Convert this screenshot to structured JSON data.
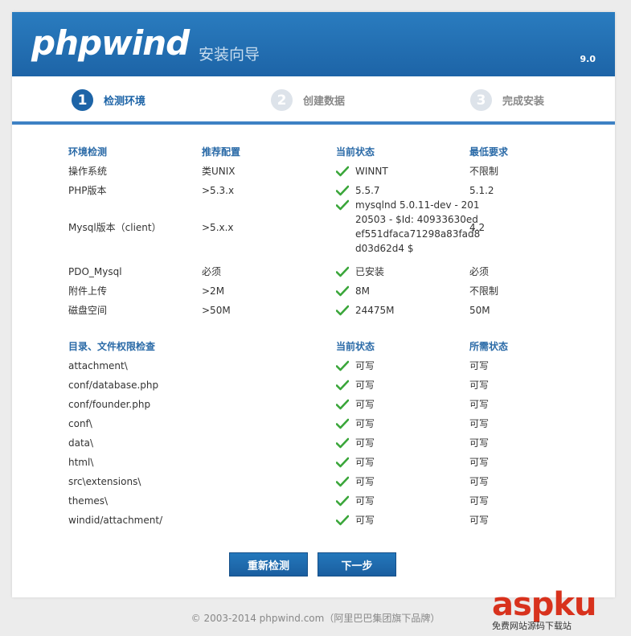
{
  "header": {
    "logo": "phpwind",
    "subtitle": "安装向导",
    "version": "9.0"
  },
  "steps": [
    {
      "num": "1",
      "label": "检测环境"
    },
    {
      "num": "2",
      "label": "创建数据"
    },
    {
      "num": "3",
      "label": "完成安装"
    }
  ],
  "env": {
    "headers": [
      "环境检测",
      "推荐配置",
      "当前状态",
      "最低要求"
    ],
    "rows": [
      {
        "item": "操作系统",
        "recommended": "类UNIX",
        "current": "WINNT",
        "minimum": "不限制"
      },
      {
        "item": "PHP版本",
        "recommended": ">5.3.x",
        "current": "5.5.7",
        "minimum": "5.1.2"
      },
      {
        "item": "Mysql版本（client）",
        "recommended": ">5.x.x",
        "current": "mysqlnd 5.0.11-dev - 20120503 - $Id: 40933630edef551dfaca71298a83fad8d03d62d4 $",
        "minimum": "4.2"
      },
      {
        "item": "PDO_Mysql",
        "recommended": "必须",
        "current": "已安装",
        "minimum": "必须"
      },
      {
        "item": "附件上传",
        "recommended": ">2M",
        "current": "8M",
        "minimum": "不限制"
      },
      {
        "item": "磁盘空间",
        "recommended": ">50M",
        "current": "24475M",
        "minimum": "50M"
      }
    ]
  },
  "perm": {
    "headers": [
      "目录、文件权限检查",
      "当前状态",
      "所需状态"
    ],
    "rows": [
      {
        "path": "attachment\\",
        "current": "可写",
        "required": "可写"
      },
      {
        "path": "conf/database.php",
        "current": "可写",
        "required": "可写"
      },
      {
        "path": "conf/founder.php",
        "current": "可写",
        "required": "可写"
      },
      {
        "path": "conf\\",
        "current": "可写",
        "required": "可写"
      },
      {
        "path": "data\\",
        "current": "可写",
        "required": "可写"
      },
      {
        "path": "html\\",
        "current": "可写",
        "required": "可写"
      },
      {
        "path": "src\\extensions\\",
        "current": "可写",
        "required": "可写"
      },
      {
        "path": "themes\\",
        "current": "可写",
        "required": "可写"
      },
      {
        "path": "windid/attachment/",
        "current": "可写",
        "required": "可写"
      }
    ]
  },
  "buttons": {
    "recheck": "重新检测",
    "next": "下一步"
  },
  "footer": "© 2003-2014 phpwind.com（阿里巴巴集团旗下品牌）",
  "watermark": {
    "brand": "aspku",
    "tagline": "免费网站源码下载站"
  },
  "icons": {
    "check": "check-icon"
  },
  "colors": {
    "accent": "#1d64a7",
    "check": "#3aa63a",
    "header_text": "#2a6aa7"
  }
}
